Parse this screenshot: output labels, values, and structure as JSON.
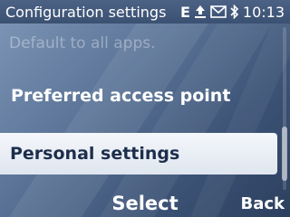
{
  "status_bar": {
    "title": "Configuration settings",
    "icons": [
      "signal-e-icon",
      "upload-icon",
      "envelope-icon",
      "bluetooth-icon"
    ],
    "signal_label": "E",
    "time": "10:13"
  },
  "menu": {
    "items": [
      {
        "label": "Default to all apps.",
        "state": "dimmed"
      },
      {
        "label": "Preferred access point",
        "state": "normal"
      },
      {
        "label": "Personal settings",
        "state": "selected"
      }
    ]
  },
  "softkeys": {
    "middle": "Select",
    "right": "Back"
  },
  "colors": {
    "status_bar": "#3b5172",
    "selected_bg": "#eef2f7",
    "selected_text": "#1d2e4c",
    "text": "#ffffff"
  }
}
